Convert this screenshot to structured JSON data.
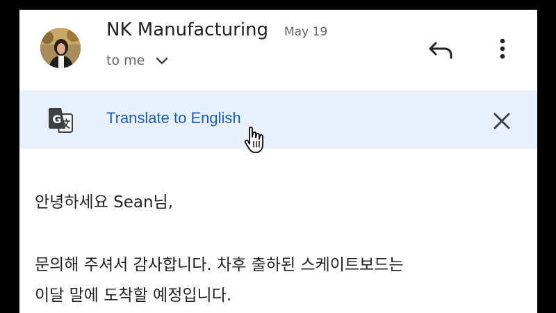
{
  "header": {
    "sender": "NK Manufacturing",
    "date": "May 19",
    "recipient": "to me",
    "avatar_icon": "person-photo-avatar",
    "reply_icon": "reply-icon",
    "more_icon": "more-vert-icon"
  },
  "translate_bar": {
    "link_label": "Translate to English",
    "icon": "google-translate-icon",
    "close_icon": "close-icon",
    "background": "#e8f0fe",
    "link_color": "#1a5fb4"
  },
  "body": {
    "greeting": "안녕하세요 Sean님,",
    "line1": "문의해 주셔서 감사합니다. 차후 출하된 스케이트보드는",
    "line2": "이달 말에 도착할 예정입니다."
  }
}
